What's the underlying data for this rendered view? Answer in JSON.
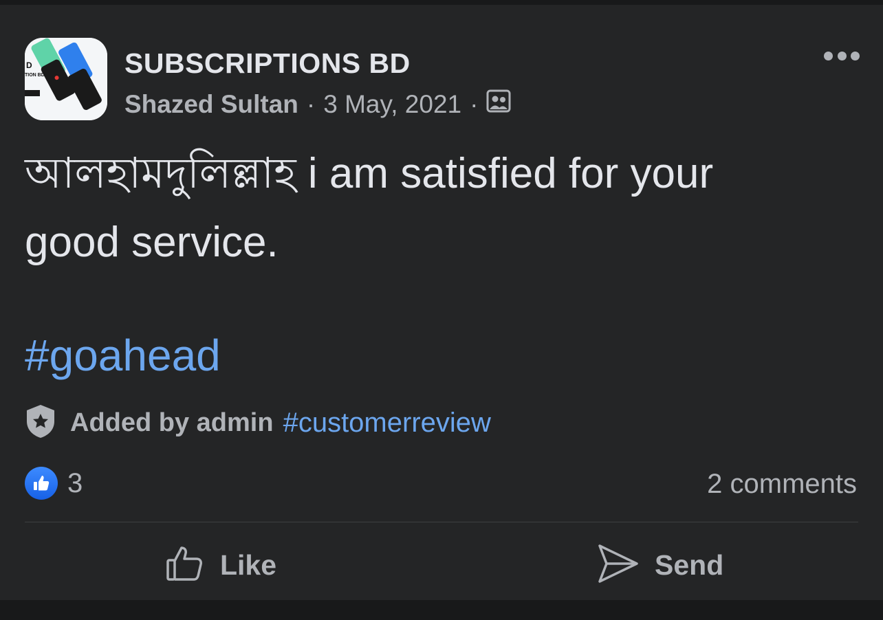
{
  "post": {
    "group_name": "SUBSCRIPTIONS BD",
    "author": "Shazed Sultan",
    "separator": "·",
    "date": "3 May, 2021",
    "privacy_icon": "group-members-icon",
    "more_icon": "more-dots-icon",
    "text_line1": "আলহামদুলিল্লাহ i am satisfied for your",
    "text_line2": "good service.",
    "hashtag": "#goahead"
  },
  "topic": {
    "icon": "admin-badge-icon",
    "label": "Added by admin",
    "hashtag": "#customerreview"
  },
  "stats": {
    "like_count": "3",
    "comments": "2 comments"
  },
  "actions": {
    "like_label": "Like",
    "send_label": "Send"
  },
  "colors": {
    "background": "#242526",
    "text": "#e4e6eb",
    "secondary": "#b0b3b8",
    "link": "#6ca6ee",
    "like_blue": "#1b74e4"
  }
}
